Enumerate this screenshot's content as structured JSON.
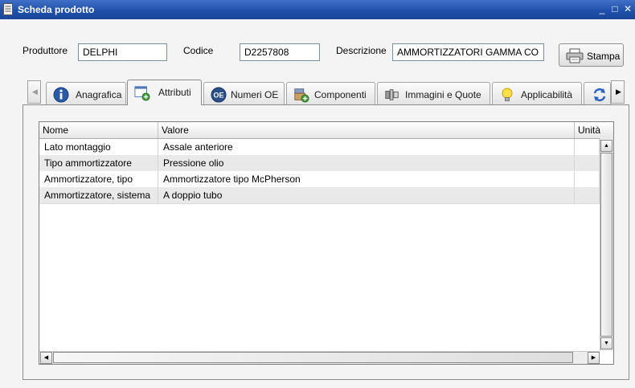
{
  "window": {
    "title": "Scheda prodotto",
    "minimize": "_",
    "maximize": "□",
    "close": "✕"
  },
  "header": {
    "produttore_label": "Produttore",
    "produttore_value": "DELPHI",
    "codice_label": "Codice",
    "codice_value": "D2257808",
    "descrizione_label": "Descrizione",
    "descrizione_value": "AMMORTIZZATORI GAMMA COI",
    "stampa_label": "Stampa"
  },
  "tabs": [
    {
      "label": "Anagrafica",
      "icon": "info-icon"
    },
    {
      "label": "Attributi",
      "icon": "attributes-icon",
      "active": true
    },
    {
      "label": "Numeri OE",
      "icon": "oe-icon"
    },
    {
      "label": "Componenti",
      "icon": "components-icon"
    },
    {
      "label": "Immagini e Quote",
      "icon": "images-icon"
    },
    {
      "label": "Applicabilità",
      "icon": "lightbulb-icon"
    }
  ],
  "grid": {
    "columns": [
      "Nome",
      "Valore",
      "Unità"
    ],
    "rows": [
      {
        "nome": "Lato montaggio",
        "valore": "Assale anteriore",
        "unita": ""
      },
      {
        "nome": "Tipo ammortizzatore",
        "valore": "Pressione olio",
        "unita": ""
      },
      {
        "nome": "Ammortizzatore, tipo",
        "valore": "Ammortizzatore tipo McPherson",
        "unita": ""
      },
      {
        "nome": "Ammortizzatore, sistema",
        "valore": "A doppio tubo",
        "unita": ""
      }
    ]
  },
  "colors": {
    "titlebar": "#1e4fa8",
    "row_alt": "#e9e9e9"
  }
}
